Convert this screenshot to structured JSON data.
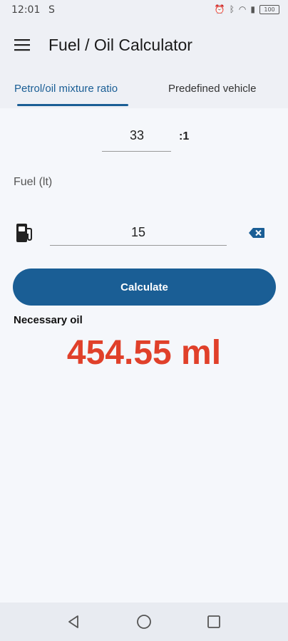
{
  "status": {
    "time": "12:01",
    "extra": "S",
    "battery": "100"
  },
  "header": {
    "title": "Fuel / Oil Calculator"
  },
  "tabs": [
    {
      "label": "Petrol/oil mixture ratio",
      "selected": true
    },
    {
      "label": "Predefined vehicle",
      "selected": false
    }
  ],
  "ratio": {
    "value": "33",
    "suffix": ":1"
  },
  "fuel": {
    "label": "Fuel (lt)",
    "value": "15"
  },
  "calculate_label": "Calculate",
  "result": {
    "label": "Necessary oil",
    "value": "454.55 ml"
  },
  "colors": {
    "accent": "#1a5e95",
    "result": "#e0402a",
    "background": "#f5f7fb"
  },
  "icons": [
    "menu-icon",
    "fuel-pump-icon",
    "backspace-icon",
    "nav-back-icon",
    "nav-home-icon",
    "nav-recent-icon"
  ]
}
